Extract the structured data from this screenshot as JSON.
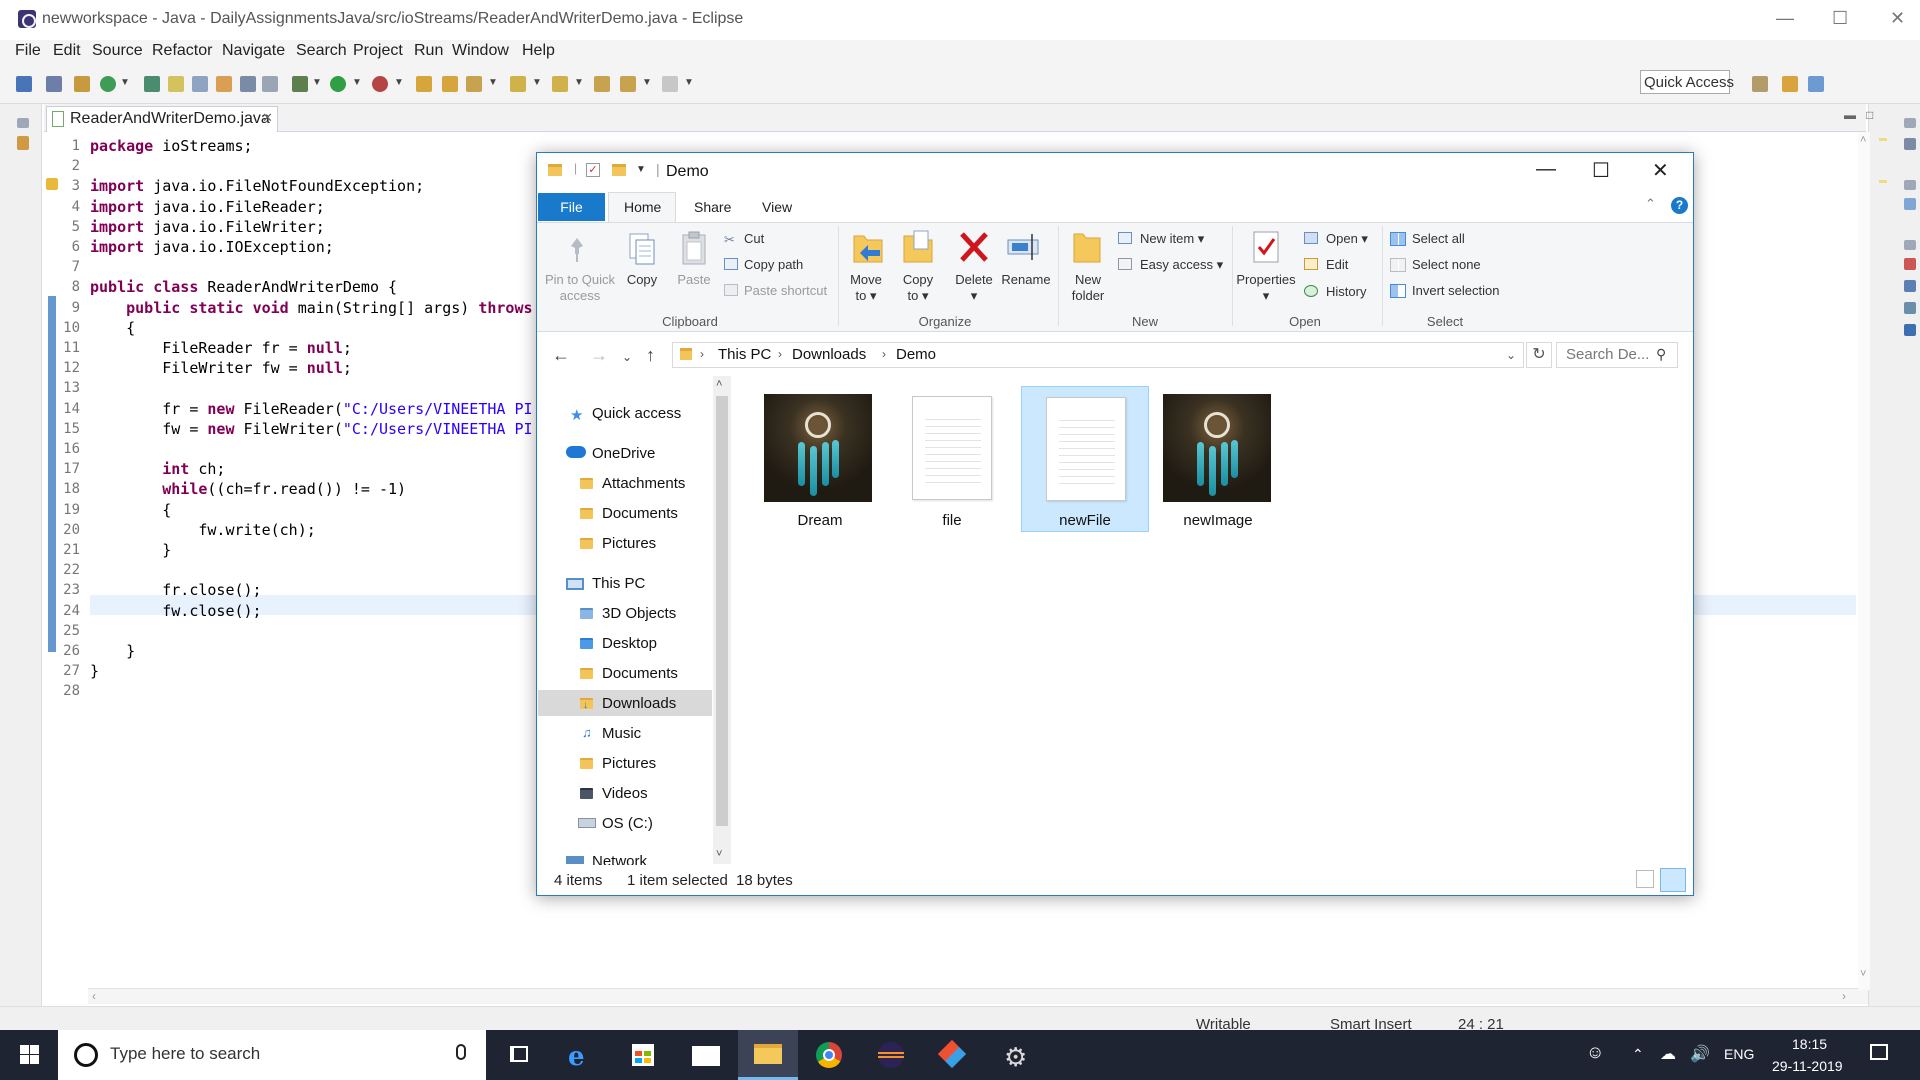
{
  "eclipse": {
    "title": "newworkspace - Java - DailyAssignmentsJava/src/ioStreams/ReaderAndWriterDemo.java - Eclipse",
    "menu": [
      "File",
      "Edit",
      "Source",
      "Refactor",
      "Navigate",
      "Search",
      "Project",
      "Run",
      "Window",
      "Help"
    ],
    "quick_access": "Quick Access",
    "editor_tab": "ReaderAndWriterDemo.java",
    "code_lines": [
      {
        "n": "1",
        "text": "package ioStreams;"
      },
      {
        "n": "2",
        "text": ""
      },
      {
        "n": "3",
        "text": "import java.io.FileNotFoundException;"
      },
      {
        "n": "4",
        "text": "import java.io.FileReader;"
      },
      {
        "n": "5",
        "text": "import java.io.FileWriter;"
      },
      {
        "n": "6",
        "text": "import java.io.IOException;"
      },
      {
        "n": "7",
        "text": ""
      },
      {
        "n": "8",
        "text": "public class ReaderAndWriterDemo {"
      },
      {
        "n": "9",
        "text": "    public static void main(String[] args) throws"
      },
      {
        "n": "10",
        "text": "    {"
      },
      {
        "n": "11",
        "text": "        FileReader fr = null;"
      },
      {
        "n": "12",
        "text": "        FileWriter fw = null;"
      },
      {
        "n": "13",
        "text": ""
      },
      {
        "n": "14",
        "text": "        fr = new FileReader(\"C:/Users/VINEETHA PI"
      },
      {
        "n": "15",
        "text": "        fw = new FileWriter(\"C:/Users/VINEETHA PI"
      },
      {
        "n": "16",
        "text": ""
      },
      {
        "n": "17",
        "text": "        int ch;"
      },
      {
        "n": "18",
        "text": "        while((ch=fr.read()) != -1)"
      },
      {
        "n": "19",
        "text": "        {"
      },
      {
        "n": "20",
        "text": "            fw.write(ch);"
      },
      {
        "n": "21",
        "text": "        }"
      },
      {
        "n": "22",
        "text": ""
      },
      {
        "n": "23",
        "text": "        fr.close();"
      },
      {
        "n": "24",
        "text": "        fw.close();"
      },
      {
        "n": "25",
        "text": ""
      },
      {
        "n": "26",
        "text": "    }"
      },
      {
        "n": "27",
        "text": "}"
      },
      {
        "n": "28",
        "text": ""
      }
    ],
    "status": {
      "mode": "Writable",
      "insert": "Smart Insert",
      "position": "24 : 21"
    }
  },
  "explorer": {
    "title": "Demo",
    "tabs": {
      "file": "File",
      "home": "Home",
      "share": "Share",
      "view": "View"
    },
    "ribbon": {
      "clipboard": {
        "pin": "Pin to Quick access",
        "copy": "Copy",
        "paste": "Paste",
        "cut": "Cut",
        "copy_path": "Copy path",
        "paste_shortcut": "Paste shortcut",
        "group": "Clipboard"
      },
      "organize": {
        "move_to": "Move to",
        "copy_to": "Copy to",
        "delete": "Delete",
        "rename": "Rename",
        "group": "Organize"
      },
      "new": {
        "new_folder": "New folder",
        "new_item": "New item",
        "easy_access": "Easy access",
        "group": "New"
      },
      "open": {
        "properties": "Properties",
        "open": "Open",
        "edit": "Edit",
        "history": "History",
        "group": "Open"
      },
      "select": {
        "select_all": "Select all",
        "select_none": "Select none",
        "invert": "Invert selection",
        "group": "Select"
      }
    },
    "breadcrumb": [
      "This PC",
      "Downloads",
      "Demo"
    ],
    "search_placeholder": "Search De...",
    "nav": {
      "quick_access": "Quick access",
      "onedrive": "OneDrive",
      "onedrive_items": [
        "Attachments",
        "Documents",
        "Pictures"
      ],
      "this_pc": "This PC",
      "this_pc_items": [
        "3D Objects",
        "Desktop",
        "Documents",
        "Downloads",
        "Music",
        "Pictures",
        "Videos",
        "OS (C:)"
      ],
      "network": "Network",
      "selected": "Downloads"
    },
    "files": [
      {
        "name": "Dream",
        "kind": "image"
      },
      {
        "name": "file",
        "kind": "document"
      },
      {
        "name": "newFile",
        "kind": "document",
        "selected": true
      },
      {
        "name": "newImage",
        "kind": "image"
      }
    ],
    "status": {
      "count": "4 items",
      "selected": "1 item selected",
      "size": "18 bytes"
    }
  },
  "taskbar": {
    "search": "Type here to search",
    "lang": "ENG",
    "time": "18:15",
    "date": "29-11-2019"
  }
}
